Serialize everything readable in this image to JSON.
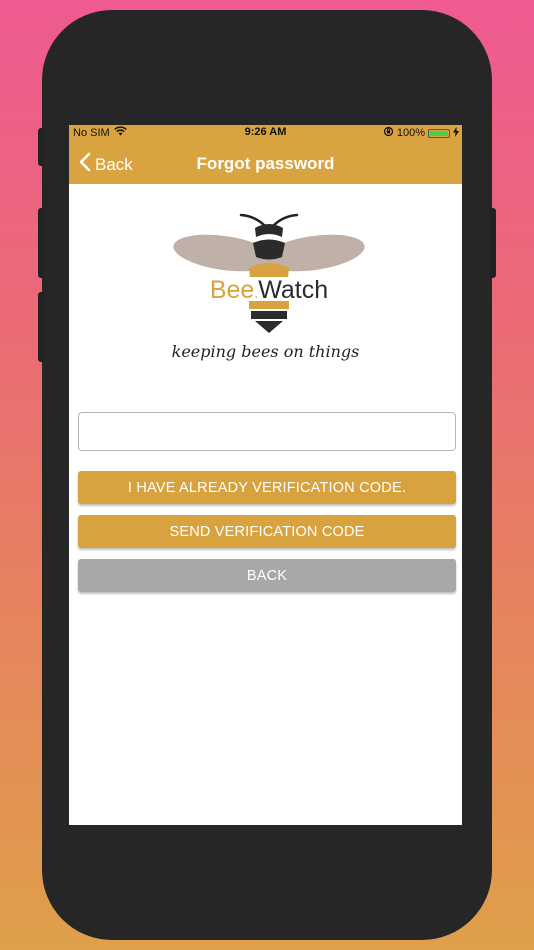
{
  "status_bar": {
    "carrier": "No SIM",
    "time": "9:26 AM",
    "battery": "100%",
    "battery_level": 1.0
  },
  "nav": {
    "back_label": "Back",
    "title": "Forgot password"
  },
  "logo": {
    "brand_part1": "Bee",
    "brand_part2": "Watch"
  },
  "tagline": "keeping bees on things",
  "form": {
    "input_value": "",
    "input_placeholder": ""
  },
  "buttons": {
    "have_code": "I HAVE ALREADY VERIFICATION CODE.",
    "send_code": "SEND VERIFICATION CODE",
    "back": "BACK"
  },
  "colors": {
    "accent": "#d9a43f",
    "secondary_button": "#a7a8aa",
    "background_top": "#ef5a91",
    "background_bottom": "#dfa04a"
  }
}
